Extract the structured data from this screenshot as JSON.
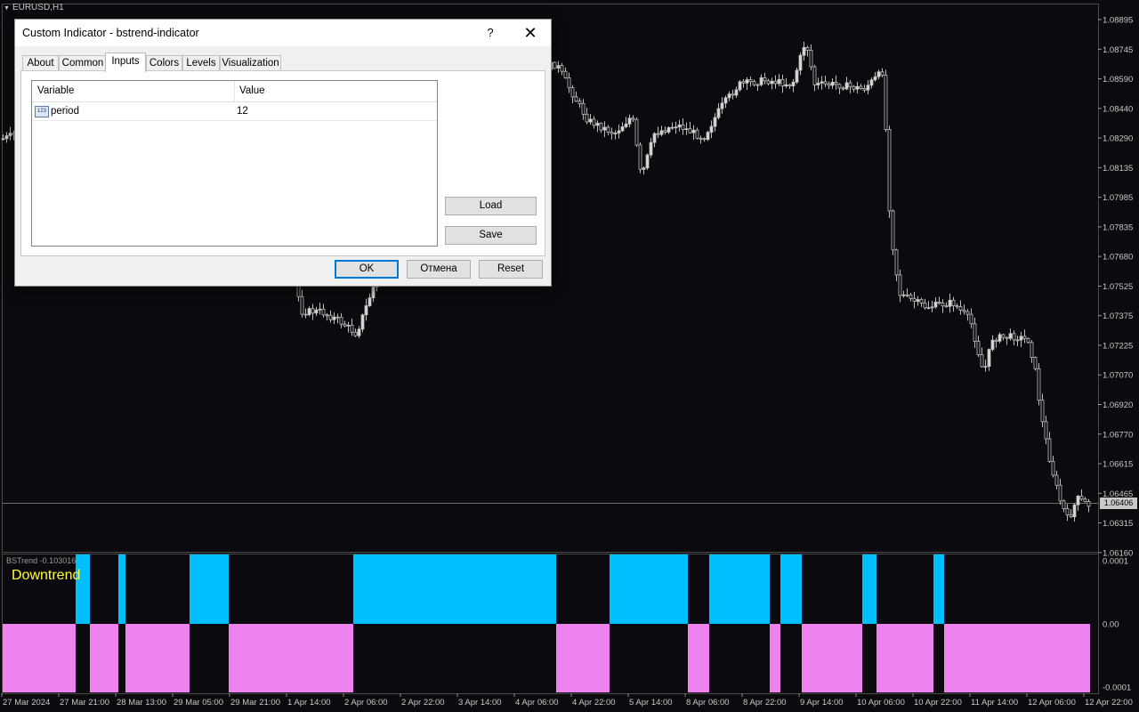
{
  "chart": {
    "symbol": "EURUSD,H1",
    "price_labels": [
      "1.08895",
      "1.08745",
      "1.08590",
      "1.08440",
      "1.08290",
      "1.08135",
      "1.07985",
      "1.07835",
      "1.07680",
      "1.07525",
      "1.07375",
      "1.07225",
      "1.07070",
      "1.06920",
      "1.06770",
      "1.06615",
      "1.06465",
      "1.06315",
      "1.06160"
    ],
    "current_price": "1.06406",
    "time_labels": [
      "27 Mar 2024",
      "27 Mar 21:00",
      "28 Mar 13:00",
      "29 Mar 05:00",
      "29 Mar 21:00",
      "1 Apr 14:00",
      "2 Apr 06:00",
      "2 Apr 22:00",
      "3 Apr 14:00",
      "4 Apr 06:00",
      "4 Apr 22:00",
      "5 Apr 14:00",
      "8 Apr 06:00",
      "8 Apr 22:00",
      "9 Apr 14:00",
      "10 Apr 06:00",
      "10 Apr 22:00",
      "11 Apr 14:00",
      "12 Apr 06:00",
      "12 Apr 22:00"
    ],
    "colors": {
      "background": "#0b0b0f",
      "candle": "#c0c0c0",
      "grid": "#3a3a3a"
    }
  },
  "indicator": {
    "name": "BSTrend -0.103016",
    "trend_text": "Downtrend",
    "scale_labels": [
      "0.0001",
      "0.00",
      "-0.0001"
    ],
    "colors": {
      "up": "#00bfff",
      "down": "#ee82ee",
      "text": "#ffff33"
    },
    "segments": [
      {
        "from": 3,
        "to": 85,
        "dir": "down"
      },
      {
        "from": 85,
        "to": 101,
        "dir": "up"
      },
      {
        "from": 101,
        "to": 133,
        "dir": "down"
      },
      {
        "from": 133,
        "to": 141,
        "dir": "up"
      },
      {
        "from": 141,
        "to": 213,
        "dir": "down"
      },
      {
        "from": 213,
        "to": 257,
        "dir": "up"
      },
      {
        "from": 257,
        "to": 397,
        "dir": "down"
      },
      {
        "from": 397,
        "to": 625,
        "dir": "up"
      },
      {
        "from": 625,
        "to": 685,
        "dir": "down"
      },
      {
        "from": 685,
        "to": 773,
        "dir": "up"
      },
      {
        "from": 773,
        "to": 797,
        "dir": "down"
      },
      {
        "from": 797,
        "to": 865,
        "dir": "up"
      },
      {
        "from": 865,
        "to": 877,
        "dir": "down"
      },
      {
        "from": 877,
        "to": 901,
        "dir": "up"
      },
      {
        "from": 901,
        "to": 969,
        "dir": "down"
      },
      {
        "from": 969,
        "to": 985,
        "dir": "up"
      },
      {
        "from": 985,
        "to": 1049,
        "dir": "down"
      },
      {
        "from": 1049,
        "to": 1061,
        "dir": "up"
      },
      {
        "from": 1061,
        "to": 1225,
        "dir": "down"
      }
    ]
  },
  "dialog": {
    "title": "Custom Indicator - bstrend-indicator",
    "help": "?",
    "tabs": [
      "About",
      "Common",
      "Inputs",
      "Colors",
      "Levels",
      "Visualization"
    ],
    "active_tab": "Inputs",
    "table": {
      "headers": [
        "Variable",
        "Value"
      ],
      "rows": [
        {
          "icon": "123",
          "name": "period",
          "value": "12"
        }
      ]
    },
    "buttons": {
      "load": "Load",
      "save": "Save",
      "ok": "OK",
      "cancel": "Отмена",
      "reset": "Reset"
    }
  }
}
